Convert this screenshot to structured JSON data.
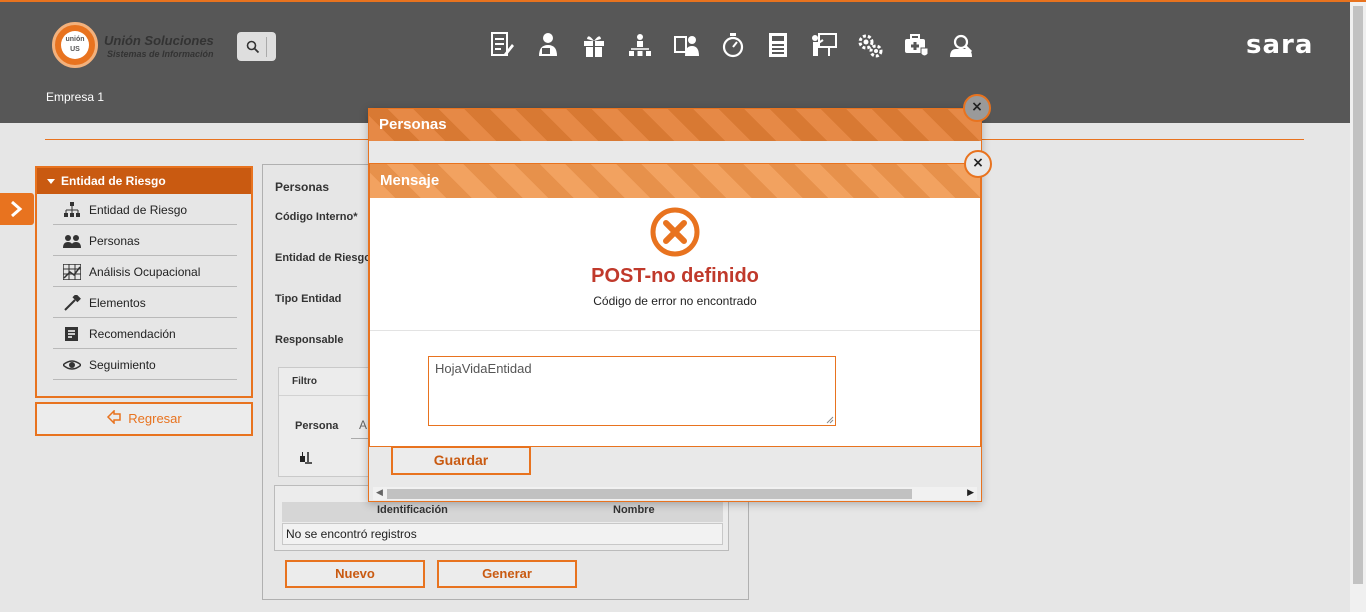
{
  "header": {
    "logo_mark": "unión US",
    "logo_title": "Unión Soluciones",
    "logo_subtitle": "Sistemas de Información",
    "brand_name": "sara",
    "company": "Empresa 1",
    "nav_icons": [
      "edit-document-icon",
      "person-card-icon",
      "gift-icon",
      "org-chart-icon",
      "id-card-person-icon",
      "stopwatch-icon",
      "newspaper-icon",
      "presentation-icon",
      "gears-icon",
      "medical-briefcase-icon",
      "inspection-icon"
    ]
  },
  "sidebar": {
    "title": "Entidad de Riesgo",
    "items": [
      {
        "label": "Entidad de Riesgo",
        "icon": "hierarchy-icon"
      },
      {
        "label": "Personas",
        "icon": "people-icon"
      },
      {
        "label": "Análisis Ocupacional",
        "icon": "chart-icon"
      },
      {
        "label": "Elementos",
        "icon": "hammer-icon"
      },
      {
        "label": "Recomendación",
        "icon": "note-icon"
      },
      {
        "label": "Seguimiento",
        "icon": "eye-icon"
      }
    ],
    "back_label": "Regresar"
  },
  "form": {
    "section": "Personas",
    "codigo_label": "Código Interno*",
    "entidad_label": "Entidad de Riesgo",
    "tipo_label": "Tipo Entidad",
    "responsable_label": "Responsable",
    "filter_title": "Filtro",
    "filter_persona_label": "Persona",
    "filter_persona_value": "A",
    "table_headers": [
      "Identificación",
      "Nombre"
    ],
    "table_empty": "No se encontró registros",
    "btn_nuevo": "Nuevo",
    "btn_generar": "Generar"
  },
  "dialog_personas": {
    "title": "Personas",
    "close": "×",
    "save_label": "Guardar"
  },
  "dialog_mensaje": {
    "title": "Mensaje",
    "close": "×",
    "error_title": "POST-no definido",
    "error_subtitle": "Código de error no encontrado",
    "detail_text": "HojaVidaEntidad"
  },
  "colors": {
    "accent": "#e8731f",
    "header_bg": "#575757",
    "error_red": "#c0392b"
  }
}
